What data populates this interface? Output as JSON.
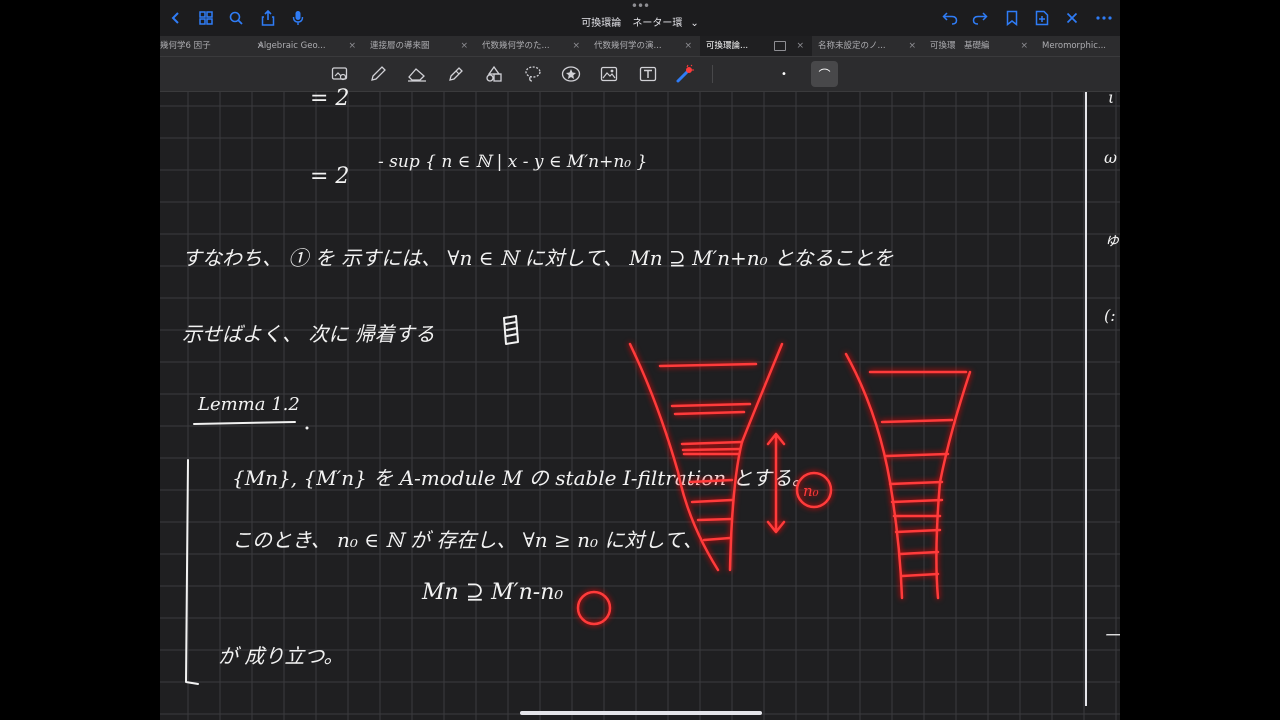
{
  "window": {
    "title": "可換環論",
    "subtitle": "ネーター環",
    "title_chevron": "⌄"
  },
  "tabs": [
    {
      "label": "幾何学6 因子"
    },
    {
      "label": "Algebraic Geo..."
    },
    {
      "label": "連接層の導来圏"
    },
    {
      "label": "代数幾何学のた..."
    },
    {
      "label": "代数幾何学の演..."
    },
    {
      "label": "可換環論..."
    },
    {
      "label": "名称未設定のノ..."
    },
    {
      "label": "可換環　基礎編"
    },
    {
      "label": "Meromorphic..."
    }
  ],
  "tab_close_glyph": "×",
  "active_tab": "可換環論...",
  "accent_color": "#2f7cf6",
  "toolbar": {
    "tools": [
      "lasso-image-icon",
      "pen-icon",
      "eraser-icon",
      "highlighter-icon",
      "shapes-icon",
      "lasso-icon",
      "sticker-icon",
      "image-icon",
      "text-icon",
      "laser-pointer-icon"
    ],
    "pen_size_dot": "•",
    "pen_stroke": "⌒"
  },
  "note": {
    "line1": "=  2",
    "line2_base": "=  2",
    "line2_exp": "- sup { n ∈ ℕ | x - y ∈ M′n+n₀ }",
    "line3": "すなわち、 ① を 示すには、  ∀n ∈ ℕ に対して、 Mn ⊇ M′n+n₀  となることを",
    "line4": "示せばよく、 次に 帰着する",
    "lemma_title": "Lemma 1.2",
    "lemma_l1": "{Mn}, {M′n} を A-module M の stable I-filtration とする。",
    "lemma_l2": "このとき、 n₀ ∈ ℕ が 存在し、 ∀n ≥ n₀ に対して、",
    "lemma_l3": "Mn ⊇ M′n-n₀",
    "lemma_l4": "が 成り立つ。",
    "red_label": "n₀",
    "margin_marks": [
      "ι",
      "ω",
      "ゅ",
      "(:",
      "一"
    ]
  },
  "colors": {
    "background": "#1f1f21",
    "grid": "#3b3b3e",
    "ink": "#f2f2f2",
    "red_ink": "#ff3b3b",
    "accent": "#2f7cf6"
  }
}
